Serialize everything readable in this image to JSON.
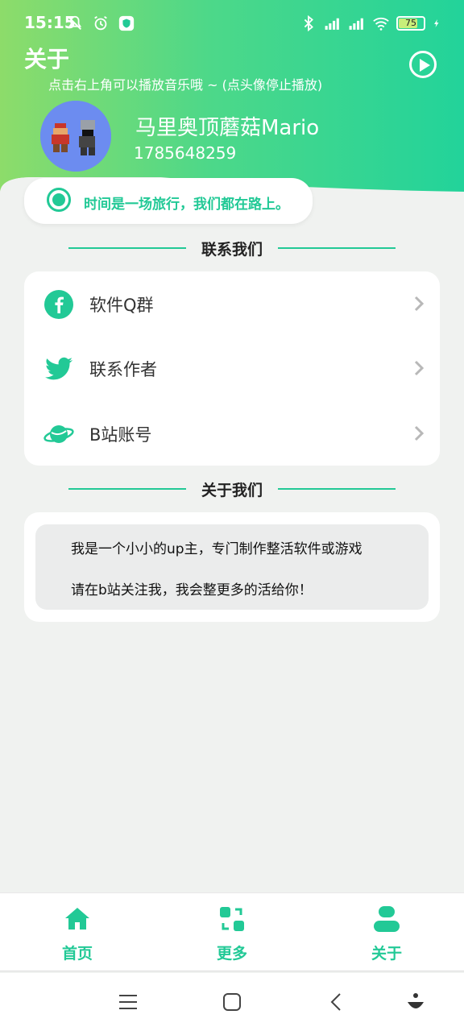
{
  "status": {
    "time": "15:15",
    "battery": "75",
    "icons": [
      "mute-bell-icon",
      "alarm-icon",
      "shield-app-icon",
      "bluetooth-icon",
      "signal-hd-icon",
      "signal-hd-icon",
      "wifi-icon",
      "charging-icon"
    ]
  },
  "header": {
    "title": "关于",
    "hint": "点击右上角可以播放音乐哦 ~ (点头像停止播放)",
    "play_icon": "play-icon"
  },
  "profile": {
    "name": "马里奥顶蘑菇Mario",
    "id": "1785648259"
  },
  "motto": "时间是一场旅行，我们都在路上。",
  "contact_section": {
    "title": "联系我们",
    "items": [
      {
        "label": "软件Q群",
        "icon": "facebook-icon"
      },
      {
        "label": "联系作者",
        "icon": "twitter-icon"
      },
      {
        "label": "B站账号",
        "icon": "planet-icon"
      }
    ]
  },
  "about_section": {
    "title": "关于我们",
    "lines": [
      "我是一个小小的up主，专门制作整活软件或游戏",
      "请在b站关注我，我会整更多的活给你！"
    ]
  },
  "tabbar": {
    "tabs": [
      {
        "label": "首页",
        "icon": "home-icon"
      },
      {
        "label": "更多",
        "icon": "refresh-grid-icon"
      },
      {
        "label": "关于",
        "icon": "user-icon"
      }
    ]
  },
  "colors": {
    "accent": "#22c996",
    "header_start": "#8ddc6a",
    "header_end": "#22d39a",
    "background": "#f0f2f0"
  }
}
